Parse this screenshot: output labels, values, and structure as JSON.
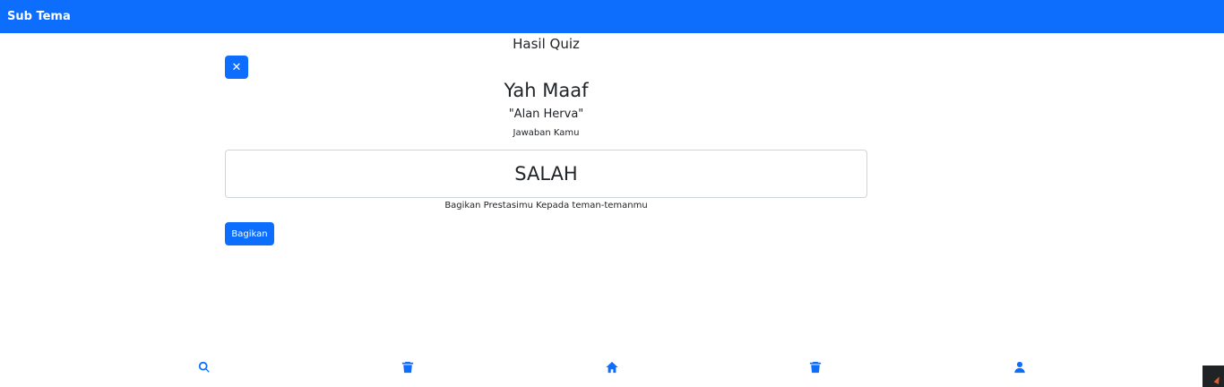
{
  "header": {
    "title": "Sub Tema"
  },
  "quiz": {
    "result_title": "Hasil Quiz",
    "close_symbol": "✕",
    "headline": "Yah Maaf",
    "username": "\"Alan Herva\"",
    "answer_label": "Jawaban Kamu",
    "answer_value": "SALAH",
    "share_text": "Bagikan Prestasimu Kepada teman-temanmu",
    "share_button": "Bagikan"
  },
  "bottom_nav": {
    "items": [
      {
        "icon": "search-icon"
      },
      {
        "icon": "trash-icon"
      },
      {
        "icon": "home-icon"
      },
      {
        "icon": "trash-icon"
      },
      {
        "icon": "user-icon"
      }
    ]
  },
  "colors": {
    "accent": "#0d6efd",
    "text": "#212529",
    "border": "#ced4da"
  }
}
